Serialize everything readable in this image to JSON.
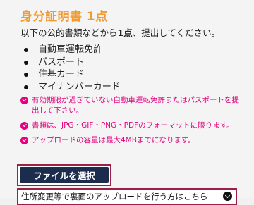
{
  "header": {
    "title": "身分証明書 1点"
  },
  "lead": {
    "before": "以下の公的書類などから",
    "count": "1点",
    "after": "、提出してください。"
  },
  "documents": [
    "自動車運転免許",
    "パスポート",
    "住基カード",
    "マイナンバーカード"
  ],
  "notes": [
    "有効期限が過ぎていない自動車運転免許またはパスポートを提出して下さい。",
    "書類は、JPG・GIF・PNG・PDFのフォーマットに限ります。",
    "アップロードの容量は最大4MBまでになります。"
  ],
  "actions": {
    "select_file_label": "ファイルを選択",
    "back_side_link": "住所変更等で裏面のアップロードを行う方はこちら"
  },
  "colors": {
    "title": "#f29a2e",
    "note": "#e6007e",
    "button_bg": "#1c2c4c",
    "highlight_border": "#9c2046"
  },
  "icons": {
    "note_icon": "check-circle-icon",
    "link_icon": "chevron-down-circle-icon"
  }
}
